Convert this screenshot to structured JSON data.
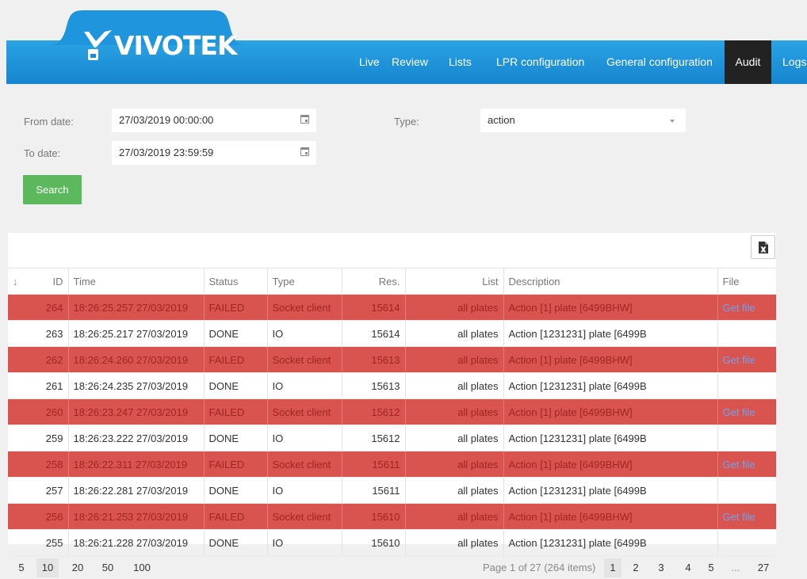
{
  "header": {
    "brand": "VIVOTEK",
    "nav": [
      {
        "label": "Live"
      },
      {
        "label": "Review"
      },
      {
        "label": "Lists"
      },
      {
        "label": "LPR configuration"
      },
      {
        "label": "General configuration"
      },
      {
        "label": "Audit"
      },
      {
        "label": "Logs"
      }
    ],
    "active_nav": "Audit"
  },
  "filters": {
    "from_label": "From date:",
    "from_value": "27/03/2019 00:00:00",
    "to_label": "To date:",
    "to_value": "27/03/2019 23:59:59",
    "type_label": "Type:",
    "type_value": "action",
    "search_label": "Search"
  },
  "grid": {
    "columns": [
      "ID",
      "Time",
      "Status",
      "Type",
      "Res.",
      "List",
      "Description",
      "File"
    ],
    "rows": [
      {
        "id": "264",
        "time": "18:26:25.257 27/03/2019",
        "status": "FAILED",
        "type": "Socket client",
        "res": "15614",
        "list": "all plates",
        "description": "Action [1] plate [6499BHW]",
        "file": "Get file"
      },
      {
        "id": "263",
        "time": "18:26:25.217 27/03/2019",
        "status": "DONE",
        "type": "IO",
        "res": "15614",
        "list": "all plates",
        "description": "Action [1231231] plate [6499B",
        "file": ""
      },
      {
        "id": "262",
        "time": "18:26:24.260 27/03/2019",
        "status": "FAILED",
        "type": "Socket client",
        "res": "15613",
        "list": "all plates",
        "description": "Action [1] plate [6499BHW]",
        "file": "Get file"
      },
      {
        "id": "261",
        "time": "18:26:24.235 27/03/2019",
        "status": "DONE",
        "type": "IO",
        "res": "15613",
        "list": "all plates",
        "description": "Action [1231231] plate [6499B",
        "file": ""
      },
      {
        "id": "260",
        "time": "18:26:23.247 27/03/2019",
        "status": "FAILED",
        "type": "Socket client",
        "res": "15612",
        "list": "all plates",
        "description": "Action [1] plate [6499BHW]",
        "file": "Get file"
      },
      {
        "id": "259",
        "time": "18:26:23.222 27/03/2019",
        "status": "DONE",
        "type": "IO",
        "res": "15612",
        "list": "all plates",
        "description": "Action [1231231] plate [6499B",
        "file": ""
      },
      {
        "id": "258",
        "time": "18:26:22.311 27/03/2019",
        "status": "FAILED",
        "type": "Socket client",
        "res": "15611",
        "list": "all plates",
        "description": "Action [1] plate [6499BHW]",
        "file": "Get file"
      },
      {
        "id": "257",
        "time": "18:26:22.281 27/03/2019",
        "status": "DONE",
        "type": "IO",
        "res": "15611",
        "list": "all plates",
        "description": "Action [1231231] plate [6499B",
        "file": ""
      },
      {
        "id": "256",
        "time": "18:26:21.253 27/03/2019",
        "status": "FAILED",
        "type": "Socket client",
        "res": "15610",
        "list": "all plates",
        "description": "Action [1] plate [6499BHW]",
        "file": "Get file"
      },
      {
        "id": "255",
        "time": "18:26:21.228 27/03/2019",
        "status": "DONE",
        "type": "IO",
        "res": "15610",
        "list": "all plates",
        "description": "Action [1231231] plate [6499B",
        "file": ""
      }
    ]
  },
  "pager": {
    "page_sizes": [
      "5",
      "10",
      "20",
      "50",
      "100"
    ],
    "selected_size": "10",
    "info": "Page 1 of 27 (264 items)",
    "pages": [
      "1",
      "2",
      "3",
      "4",
      "5",
      "...",
      "27"
    ],
    "current_page": "1"
  },
  "colors": {
    "header_blue": "#1a8ed8",
    "failed_row": "#d9534f",
    "search_green": "#5cb85c",
    "active_nav": "#222222"
  }
}
